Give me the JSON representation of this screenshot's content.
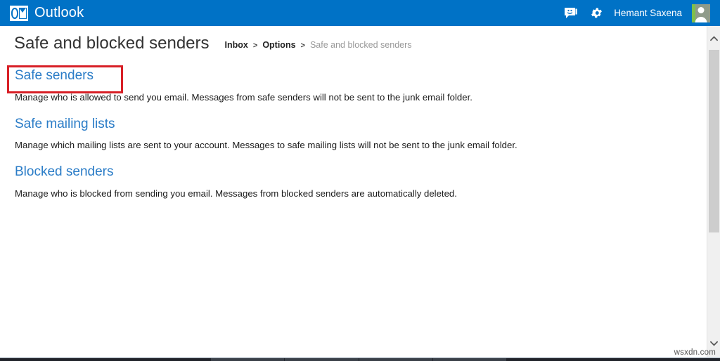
{
  "suite": {
    "brand_name": "Outlook",
    "brand_logo_icon": "outlook-logo-icon",
    "chat_icon": "chat-bubble-icon",
    "settings_icon": "gear-icon",
    "user_name": "Hemant Saxena",
    "avatar_icon": "user-avatar-icon",
    "bar_color": "#0072c6"
  },
  "header": {
    "page_title": "Safe and blocked senders",
    "breadcrumb": {
      "items": [
        {
          "label": "Inbox",
          "current": false
        },
        {
          "label": "Options",
          "current": false
        },
        {
          "label": "Safe and blocked senders",
          "current": true
        }
      ],
      "separator": ">"
    }
  },
  "main": {
    "sections": [
      {
        "link": "Safe senders",
        "description": "Manage who is allowed to send you email. Messages from safe senders will not be sent to the junk email folder.",
        "highlighted": true
      },
      {
        "link": "Safe mailing lists",
        "description": "Manage which mailing lists are sent to your account. Messages to safe mailing lists will not be sent to the junk email folder.",
        "highlighted": false
      },
      {
        "link": "Blocked senders",
        "description": "Manage who is blocked from sending you email. Messages from blocked senders are automatically deleted.",
        "highlighted": false
      }
    ],
    "link_color": "#2a7cc7",
    "annotation_color": "#d81f26"
  },
  "scrollbar": {
    "up_arrow_icon": "chevron-up-icon",
    "down_arrow_icon": "chevron-down-icon",
    "orientation": "vertical"
  },
  "watermark": {
    "text": "wsxdn.com"
  }
}
